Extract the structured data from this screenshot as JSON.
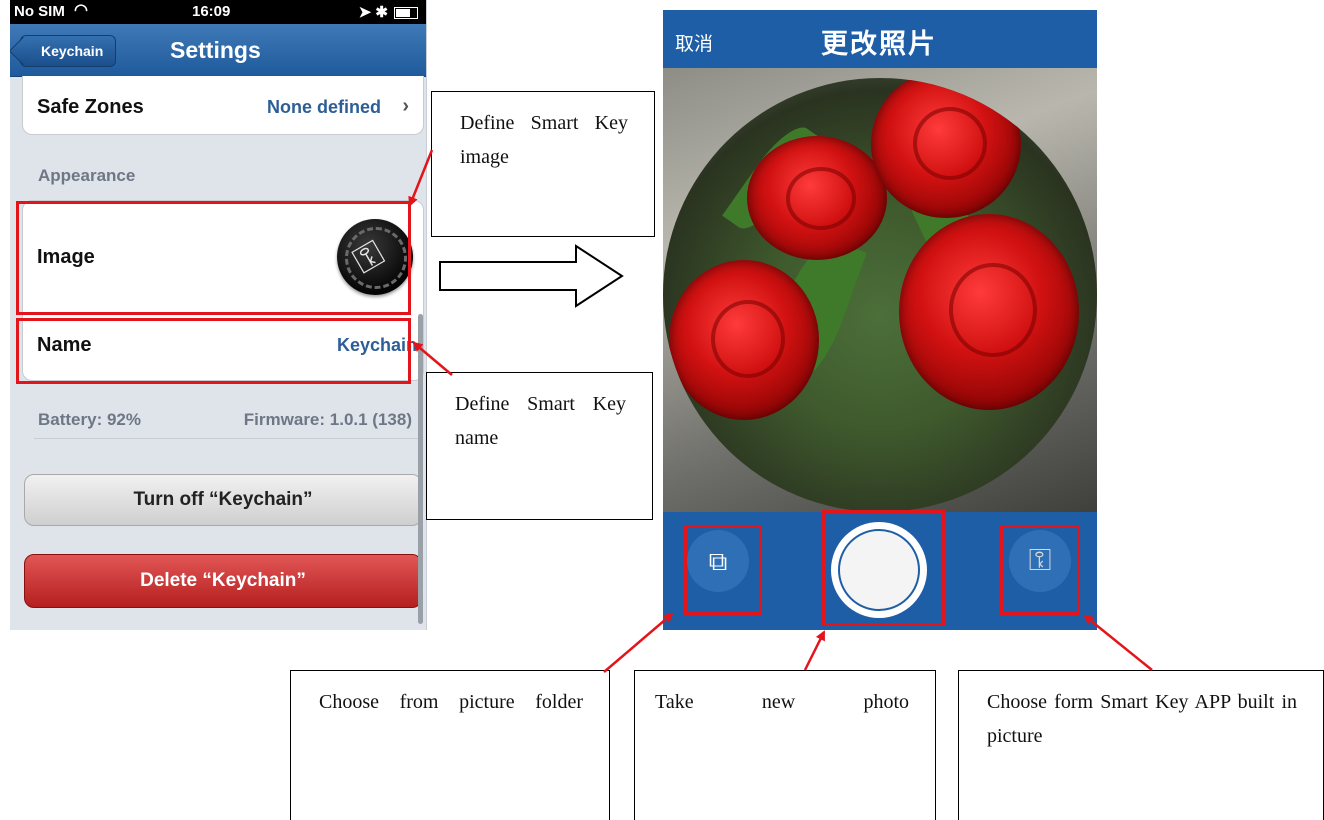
{
  "settings_screen": {
    "status_bar": {
      "carrier": "No SIM",
      "time": "16:09"
    },
    "nav": {
      "back_label": "Keychain",
      "title": "Settings"
    },
    "safe_zones": {
      "label": "Safe Zones",
      "value": "None defined"
    },
    "section_header": "Appearance",
    "image_row": {
      "label": "Image"
    },
    "name_row": {
      "label": "Name",
      "value": "Keychain"
    },
    "battery": "Battery: 92%",
    "firmware": "Firmware: 1.0.1 (138)",
    "turn_off_button": "Turn off “Keychain”",
    "delete_button": "Delete “Keychain”"
  },
  "photo_screen": {
    "cancel_label": "取消",
    "title": "更改照片"
  },
  "callouts": {
    "define_image": "Define Smart Key image",
    "define_name": "Define Smart Key name",
    "choose_folder": "Choose from picture folder",
    "take_photo": "Take new photo",
    "choose_builtin": "Choose form Smart Key APP built in picture"
  },
  "icons": {
    "wifi": "wifi-icon",
    "key": "key-icon",
    "gallery": "gallery-icon",
    "shutter": "shutter-icon",
    "arrow": "right-arrow-icon"
  },
  "colors": {
    "nav_blue": "#1f5a9c",
    "photo_blue": "#1d5ea6",
    "highlight_red": "#e3141a",
    "delete_red": "#c62828"
  }
}
